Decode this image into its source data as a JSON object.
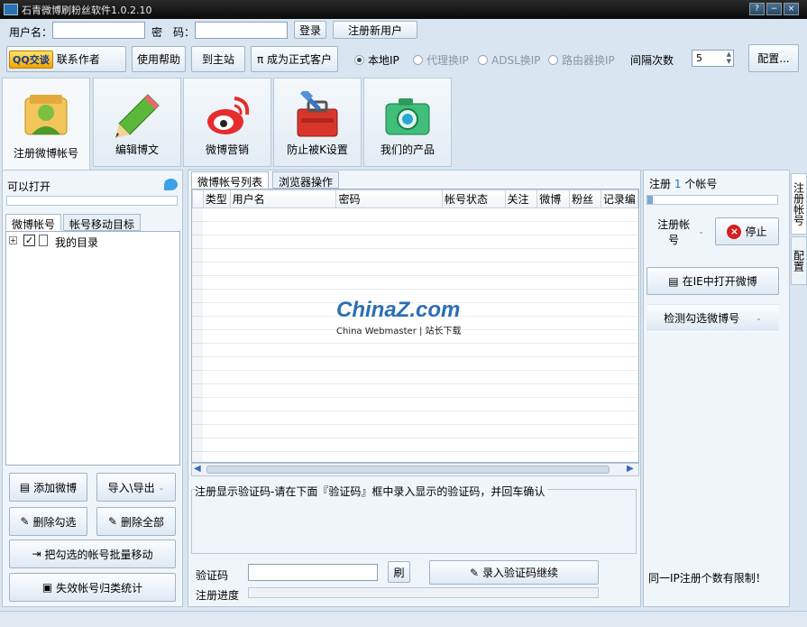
{
  "window": {
    "title": "石青微博刷粉丝软件1.0.2.10",
    "btn_help": "?",
    "btn_min": "−",
    "btn_max": "□",
    "btn_close": "×"
  },
  "login": {
    "username_label": "用户名：",
    "password_label": "密　码：",
    "username_value": "",
    "password_value": "",
    "login_btn": "登录",
    "register_btn": "注册新用户"
  },
  "toolbar": {
    "qq_btn": "QQ交谈",
    "contact": "联系作者",
    "help": "使用帮助",
    "home": "到主站",
    "become": "π 成为正式客户",
    "radio_local": "本地IP",
    "radio_proxy": "代理换IP",
    "radio_adsl": "ADSL换IP",
    "radio_router": "路由器换IP",
    "interval_label": "间隔次数",
    "interval_value": "5",
    "config_btn": "配置..."
  },
  "bigtabs": [
    {
      "label": "注册微博帐号",
      "icon": "user-card-icon"
    },
    {
      "label": "编辑博文",
      "icon": "pencil-icon"
    },
    {
      "label": "微博营销",
      "icon": "weibo-logo-icon"
    },
    {
      "label": "防止被K设置",
      "icon": "toolbox-icon"
    },
    {
      "label": "我们的产品",
      "icon": "camera-icon"
    }
  ],
  "left": {
    "status": "可以打开",
    "tab_accounts": "微博帐号",
    "tab_move": "帐号移动目标",
    "tree_root": "我的目录",
    "add_btn": "添加微博",
    "import_btn": "导入\\导出",
    "del_checked": "删除勾选",
    "del_all": "删除全部",
    "batch_move": "把勾选的帐号批量移动",
    "invalid_stats": "失效帐号归类统计"
  },
  "center": {
    "tab_list": "微博帐号列表",
    "tab_browser": "浏览器操作",
    "columns": [
      "类型",
      "用户名",
      "密码",
      "帐号状态",
      "关注",
      "微博",
      "粉丝",
      "记录编"
    ],
    "captcha_group": "注册显示验证码-请在下面『验证码』框中录入显示的验证码，并回车确认",
    "captcha_label": "验证码",
    "captcha_value": "",
    "refresh_btn": "刷",
    "submit_btn": "录入验证码继续",
    "progress_label": "注册进度",
    "watermark_main": "ChinaZ.com",
    "watermark_sub": "China Webmaster | 站长下载"
  },
  "right": {
    "reg_count_prefix": "注册",
    "reg_count": "1",
    "reg_count_suffix": "个帐号",
    "reg_btn": "注册帐号",
    "stop_btn": "停止",
    "open_ie_btn": "在IE中打开微博",
    "check_btn": "检测勾选微博号",
    "note": "同一IP注册个数有限制！",
    "vtab_reg": "注册帐号",
    "vtab_cfg": "配置"
  },
  "colors": {
    "accent": "#2b6fb5",
    "stop_red": "#d42020"
  }
}
